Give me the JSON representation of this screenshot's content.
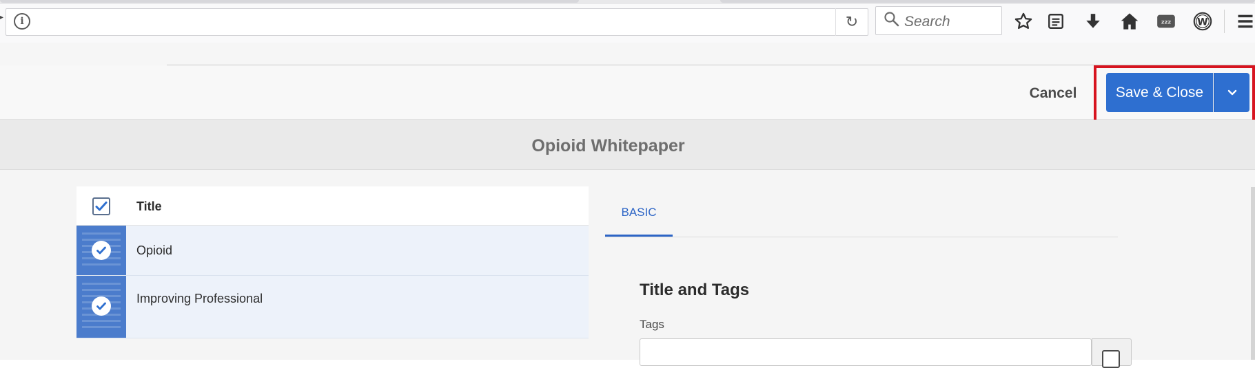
{
  "browser": {
    "search_placeholder": "Search",
    "icons": [
      "info-icon",
      "reload-icon",
      "search-icon",
      "bookmark-star-icon",
      "reader-list-icon",
      "download-icon",
      "home-icon",
      "zzz-extension-icon",
      "w-extension-icon",
      "hamburger-menu-icon"
    ]
  },
  "header": {
    "cancel_label": "Cancel",
    "save_label": "Save & Close",
    "dropdown_icon": "chevron-down-icon",
    "accent_color": "#2e6fd0",
    "highlight_color": "#d7141f"
  },
  "page": {
    "title": "Opioid Whitepaper"
  },
  "list": {
    "column_title": "Title",
    "rows": [
      {
        "label": "Opioid",
        "selected": true
      },
      {
        "label": "Improving Professional",
        "selected": true
      }
    ]
  },
  "properties": {
    "tabs": [
      {
        "label": "BASIC",
        "active": true
      }
    ],
    "section_title": "Title and Tags",
    "tags_label": "Tags",
    "tags_value": ""
  }
}
